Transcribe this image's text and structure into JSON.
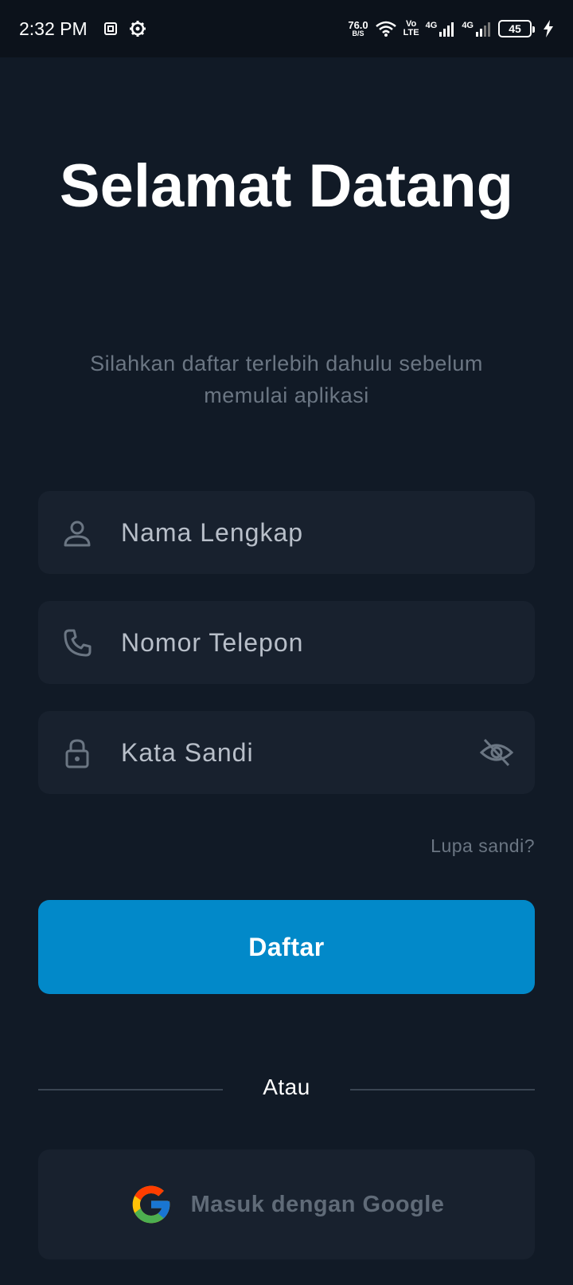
{
  "status_bar": {
    "time": "2:32 PM",
    "net_speed_value": "76.0",
    "net_speed_unit": "B/S",
    "volte_top": "Vo",
    "volte_bottom": "LTE",
    "sim1_label": "4G",
    "sim2_label": "4G",
    "battery_level": "45"
  },
  "header": {
    "title": "Selamat Datang",
    "subtitle": "Silahkan daftar terlebih dahulu sebelum memulai aplikasi"
  },
  "form": {
    "name_placeholder": "Nama Lengkap",
    "phone_placeholder": "Nomor Telepon",
    "password_placeholder": "Kata Sandi",
    "forgot_label": "Lupa sandi?",
    "submit_label": "Daftar"
  },
  "divider": {
    "label": "Atau"
  },
  "google": {
    "label": "Masuk dengan Google"
  },
  "colors": {
    "background": "#111a26",
    "field_bg": "#18212e",
    "primary": "#0289c9",
    "muted_text": "#6b7683"
  }
}
